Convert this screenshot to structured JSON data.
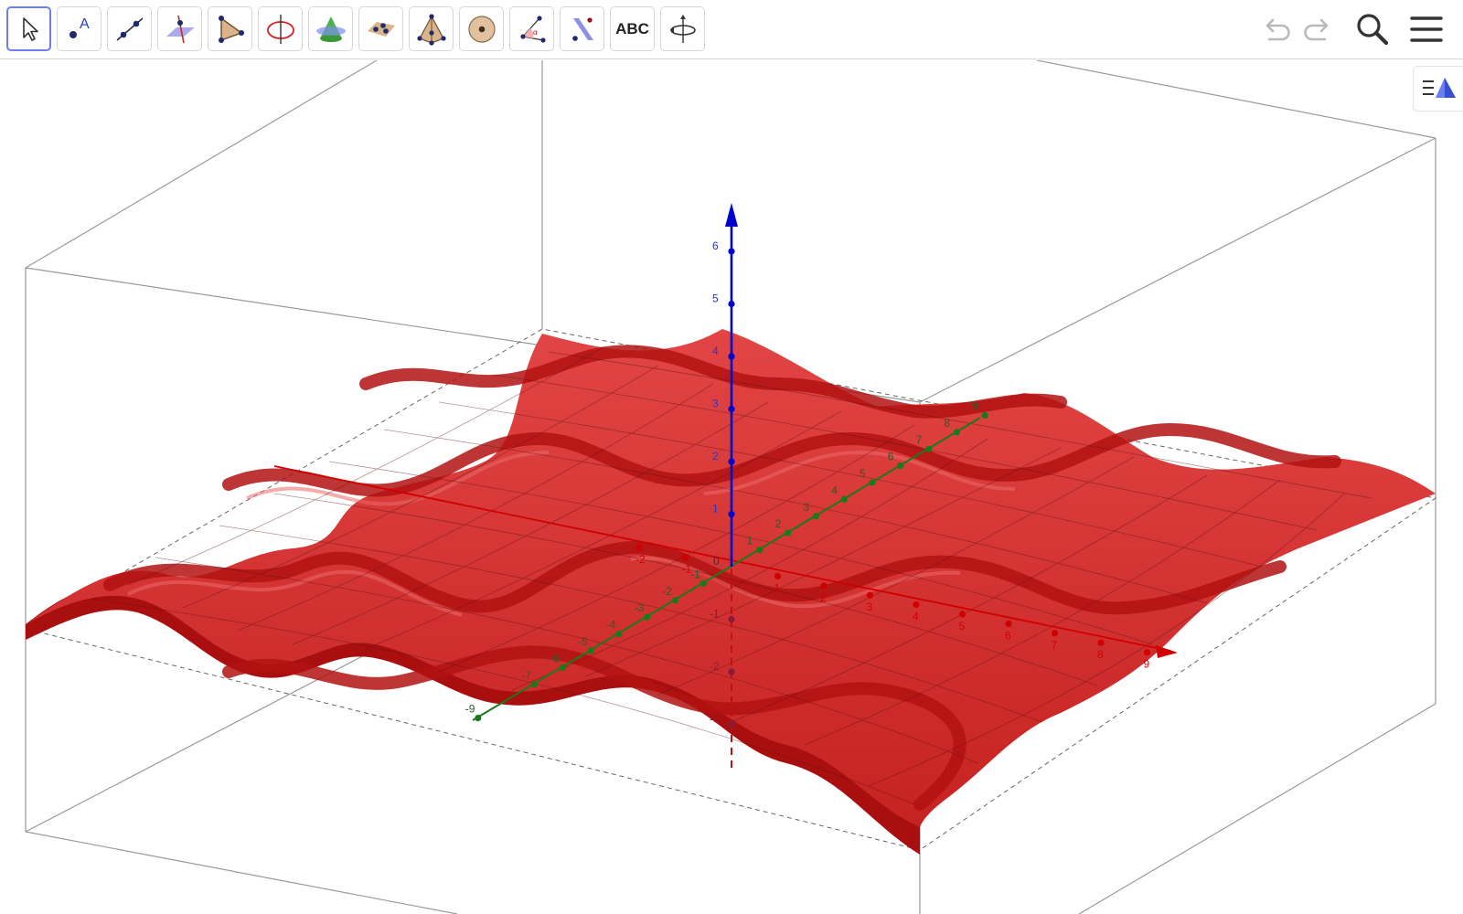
{
  "app": {
    "toolbar": {
      "tools": [
        {
          "name": "move-tool",
          "icon": "arrow-cursor-icon",
          "active": true
        },
        {
          "name": "point-tool",
          "icon": "point-icon"
        },
        {
          "name": "line-tool",
          "icon": "line-icon"
        },
        {
          "name": "perpendicular-line-tool",
          "icon": "perpendicular-plane-icon"
        },
        {
          "name": "polygon-tool",
          "icon": "polygon-icon"
        },
        {
          "name": "circle-around-axis-tool",
          "icon": "circle-axis-icon"
        },
        {
          "name": "intersect-surfaces-tool",
          "icon": "cone-plane-icon"
        },
        {
          "name": "plane-through-points-tool",
          "icon": "plane-points-icon"
        },
        {
          "name": "pyramid-tool",
          "icon": "pyramid-icon"
        },
        {
          "name": "sphere-tool",
          "icon": "sphere-icon"
        },
        {
          "name": "angle-tool",
          "icon": "angle-icon"
        },
        {
          "name": "reflect-tool",
          "icon": "reflect-icon"
        },
        {
          "name": "text-tool",
          "icon": "text-icon",
          "label": "ABC"
        },
        {
          "name": "rotate-view-tool",
          "icon": "rotate-view-icon"
        }
      ],
      "actions": [
        {
          "name": "undo-button",
          "icon": "undo-icon"
        },
        {
          "name": "redo-button",
          "icon": "redo-icon"
        },
        {
          "name": "search-button",
          "icon": "search-icon"
        },
        {
          "name": "menu-button",
          "icon": "hamburger-menu-icon"
        }
      ]
    },
    "view_toggle": {
      "icon": "graphics-3d-view-icon"
    }
  },
  "graph3d": {
    "colors": {
      "surface": "#d92626",
      "surface_dark": "#a90f0f",
      "x_axis": "#d00000",
      "y_axis": "#1a7a1a",
      "z_axis": "#0000cc",
      "box": "#9a9a9a",
      "accent": "#6b7ff2"
    },
    "x_axis": {
      "ticks": [
        "-2",
        "-1",
        "1",
        "2",
        "3",
        "4",
        "5",
        "6",
        "7",
        "8",
        "9"
      ]
    },
    "y_axis": {
      "ticks": [
        "-9",
        "-7",
        "-6",
        "-5",
        "-4",
        "-3",
        "-2",
        "-1",
        "1",
        "2",
        "3",
        "4",
        "5",
        "6",
        "7",
        "8",
        "9"
      ]
    },
    "z_axis": {
      "ticks": [
        "1",
        "2",
        "3",
        "4",
        "5",
        "6"
      ],
      "neg_ticks": [
        "-1",
        "-2",
        "-3"
      ]
    },
    "origin_label": "0"
  }
}
